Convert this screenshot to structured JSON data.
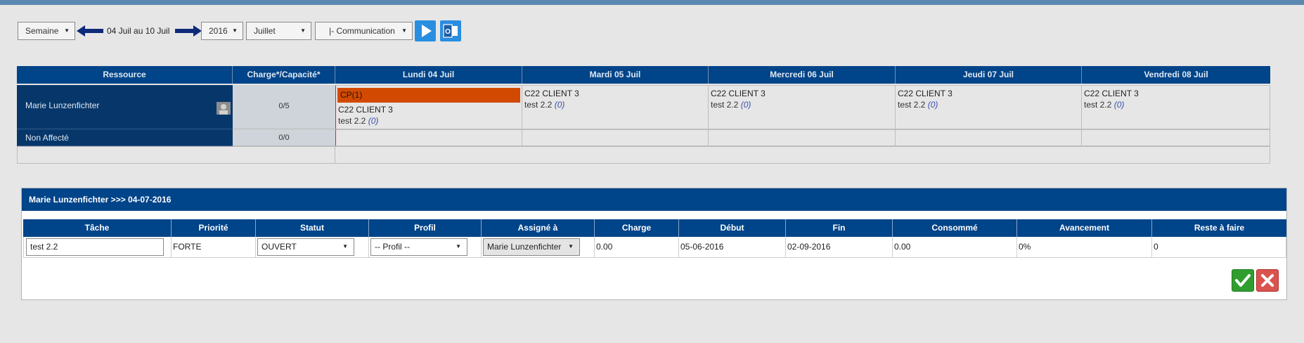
{
  "toolbar": {
    "view_select": "Semaine",
    "date_range": "04 Juil au 10 Juil",
    "year_select": "2016",
    "month_select": "Juillet",
    "group_select": "|- Communication"
  },
  "grid": {
    "headers": [
      "Ressource",
      "Charge*/Capacité*",
      "Lundi 04 Juil",
      "Mardi 05 Juil",
      "Mercredi 06 Juil",
      "Jeudi 07 Juil",
      "Vendredi 08 Juil"
    ],
    "rows": [
      {
        "resource": "Marie Lunzenfichter",
        "charge": "0/5",
        "days": [
          {
            "cp": "CP(1)",
            "client": "C22 CLIENT 3",
            "task": "test 2.2",
            "count": "(0)"
          },
          {
            "client": "C22 CLIENT 3",
            "task": "test 2.2",
            "count": "(0)"
          },
          {
            "client": "C22 CLIENT 3",
            "task": "test 2.2",
            "count": "(0)"
          },
          {
            "client": "C22 CLIENT 3",
            "task": "test 2.2",
            "count": "(0)"
          },
          {
            "client": "C22 CLIENT 3",
            "task": "test 2.2",
            "count": "(0)"
          }
        ]
      },
      {
        "resource": "Non Affecté",
        "charge": "0/0"
      }
    ]
  },
  "dialog": {
    "title": "Marie Lunzenfichter >>> 04-07-2016",
    "columns": [
      "Tâche",
      "Priorité",
      "Statut",
      "Profil",
      "Assigné à",
      "Charge",
      "Début",
      "Fin",
      "Consommé",
      "Avancement",
      "Reste à faire"
    ],
    "row": {
      "tache": "test 2.2",
      "priorite": "FORTE",
      "statut": "OUVERT",
      "profil": "-- Profil --",
      "assigne": "Marie Lunzenfichter",
      "charge": "0.00",
      "debut": "05-06-2016",
      "fin": "02-09-2016",
      "consomme": "0.00",
      "avancement": "0%",
      "reste": "0"
    }
  },
  "colors": {
    "header": "#004489",
    "resource_bg": "#07376a",
    "cp_event": "#d24a02",
    "ok": "#2f9e2f",
    "cancel": "#d9534f"
  },
  "icons": [
    "arrow-left-icon",
    "arrow-right-icon",
    "play-icon",
    "outlook-icon",
    "check-icon",
    "close-icon",
    "chevron-down-icon",
    "avatar"
  ]
}
